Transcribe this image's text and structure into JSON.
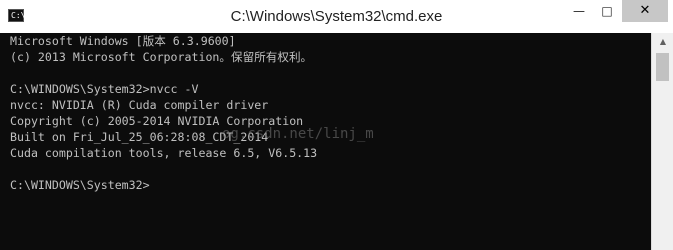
{
  "window": {
    "title": "C:\\Windows\\System32\\cmd.exe",
    "icon_label": "C:\\"
  },
  "controls": {
    "minimize": "—",
    "maximize": "□",
    "close": "✕"
  },
  "console": {
    "lines": [
      "Microsoft Windows [版本 6.3.9600]",
      "(c) 2013 Microsoft Corporation。保留所有权利。",
      "",
      "C:\\WINDOWS\\System32>nvcc -V",
      "nvcc: NVIDIA (R) Cuda compiler driver",
      "Copyright (c) 2005-2014 NVIDIA Corporation",
      "Built on Fri_Jul_25_06:28:08_CDT_2014",
      "Cuda compilation tools, release 6.5, V6.5.13",
      "",
      "C:\\WINDOWS\\System32>"
    ],
    "watermark": "og.csdn.net/linj_m"
  },
  "colors": {
    "console_bg": "#0c0c0c",
    "console_text": "#c0c0c0",
    "close_hover": "#c7c7c7"
  }
}
